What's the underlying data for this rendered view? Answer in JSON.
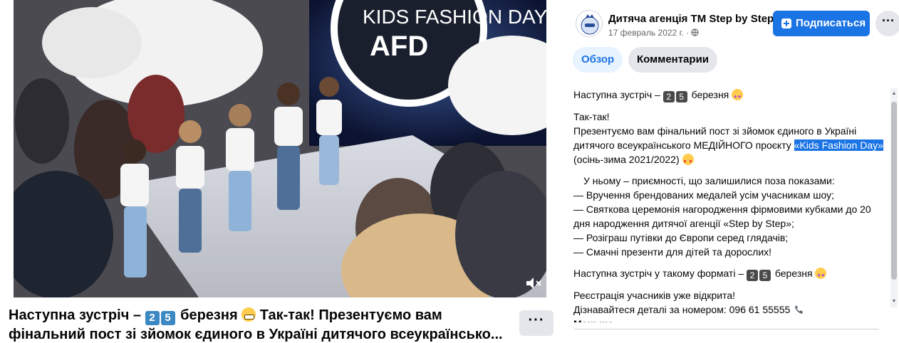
{
  "video": {
    "backdrop_text": "KIDS FASHION DAY",
    "logo_text": "AFD"
  },
  "caption": {
    "part1": "Наступна зустріч – ",
    "digit1": "2",
    "digit2": "5",
    "part2": " березня ",
    "part3": " Так-так! Презентуємо вам фінальний пост зі зйомок єдиного в Україні дитячого всеукраїнсько..."
  },
  "header": {
    "page_name": "Дитяча агенція ТМ Step by Step",
    "date": "17 февраль 2022 г. ·",
    "subscribe_label": "Подписаться",
    "more_label": "···"
  },
  "tabs": [
    {
      "label": "Обзор",
      "active": true
    },
    {
      "label": "Комментарии",
      "active": false
    }
  ],
  "post": {
    "l1_a": "Наступна зустріч – ",
    "l1_d1": "2",
    "l1_d2": "5",
    "l1_b": " березня ",
    "l2": "Так-так!",
    "l3_a": "Презентуємо вам фінальний пост зі зйомок єдиного в Україні дитячого всеукраїнського МЕДІЙНОГО проєкту ",
    "l3_hl": "«Kids Fashion Day»",
    "l3_b": " (осінь-зима 2021/2022) ",
    "l4": "У ньому – приємності, що залишилися поза показами:",
    "l5": "— Вручення брендованих медалей усім учасникам шоу;",
    "l6": "— Святкова церемонія нагородження фірмовими кубками до 20 дня народження дитячої агенції «Step by Step»;",
    "l7": "— Розіграш путівки до Європи серед глядачів;",
    "l8": "— Смачні презенти для дітей та дорослих!",
    "l9_a": "Наступна зустріч у такому форматі – ",
    "l9_d1": "2",
    "l9_d2": "5",
    "l9_b": " березня ",
    "l10": "Реєстрація учасників уже відкрита!",
    "l11": "Дізнавайтеся деталі за номером: 096 61 55555 ",
    "less": "Меньше"
  },
  "colors": {
    "accent": "#1b74e4",
    "tab_active_bg": "#e7f3ff",
    "button_gray": "#e4e6eb",
    "secondary_text": "#65676b"
  },
  "icons": [
    "mute-icon",
    "globe-icon",
    "plus-icon",
    "phone-icon",
    "more-icon"
  ]
}
